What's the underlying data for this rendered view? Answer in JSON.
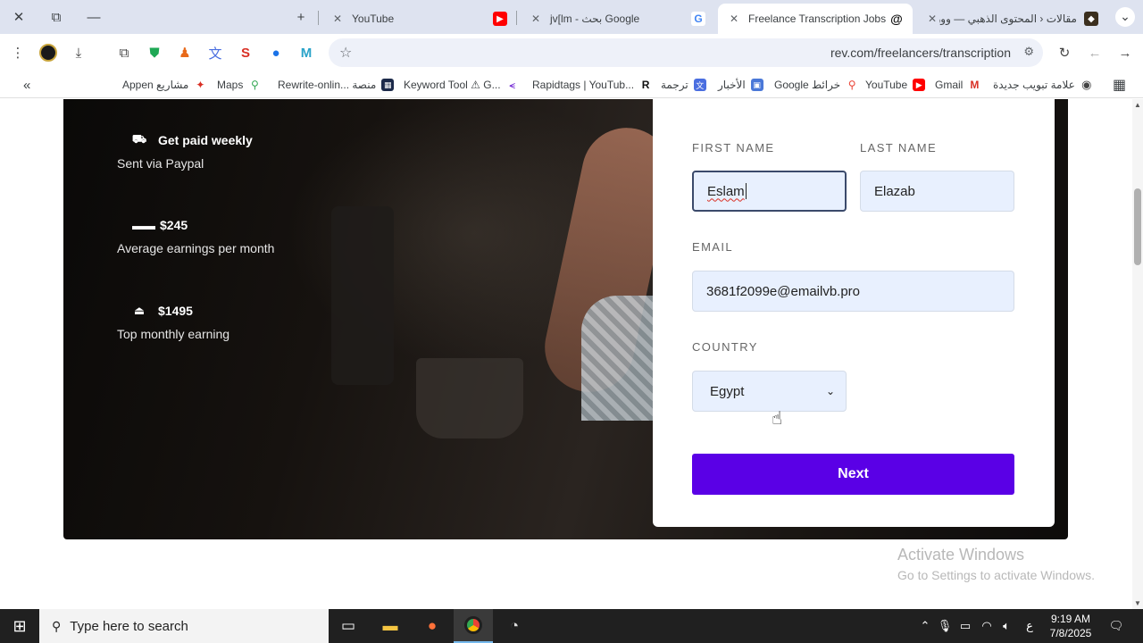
{
  "window": {
    "close": "✕",
    "restore": "⧉",
    "minimize": "—"
  },
  "tabs": [
    {
      "title": "YouTube",
      "favicon": "youtube-icon",
      "color": "#ff0000"
    },
    {
      "title": "jv[lm - بحث Google",
      "favicon": "google-icon",
      "color": "#4285f4"
    },
    {
      "title": "Freelance Transcription Jobs | Tr",
      "favicon": "rev-icon",
      "color": "#111111",
      "active": true
    },
    {
      "title": "مقالات ‹ المحتوى الذهبي — ووردب",
      "favicon": "wordpress-icon",
      "color": "#555555"
    }
  ],
  "new_tab": "+",
  "tab_search": "⌄",
  "toolbar": {
    "url": "rev.com/freelancers/transcription"
  },
  "bookmarks": [
    "Appen مشاريع",
    "Maps",
    "Rewrite-onlin... منصة",
    "Keyword Tool ⚠ G...",
    "Rapidtags | YouTub...",
    "ترجمة",
    "الأخبار",
    "Google خرائط",
    "YouTube",
    "Gmail",
    "علامة تبويب جديدة"
  ],
  "bookmarks_more": "«",
  "stats": [
    {
      "title": "Get paid weekly",
      "subtitle": "Sent via Paypal",
      "icon": "money-truck-icon"
    },
    {
      "title": "$245",
      "subtitle": "Average earnings per month",
      "icon": "money-stack-icon"
    },
    {
      "title": "$1495",
      "subtitle": "Top monthly earning",
      "icon": "trophy-icon"
    }
  ],
  "form": {
    "first_name_label": "FIRST NAME",
    "first_name_value": "Eslam",
    "last_name_label": "LAST NAME",
    "last_name_value": "Elazab",
    "email_label": "EMAIL",
    "email_value": "3681f2099e@emailvb.pro",
    "country_label": "COUNTRY",
    "country_value": "Egypt",
    "next_label": "Next",
    "next_color": "#5a00e6"
  },
  "watermark": {
    "title": "Activate Windows",
    "subtitle": "Go to Settings to activate Windows."
  },
  "taskbar": {
    "search_placeholder": "Type here to search",
    "language": "ع",
    "time": "9:19 AM",
    "date": "7/8/2025"
  }
}
